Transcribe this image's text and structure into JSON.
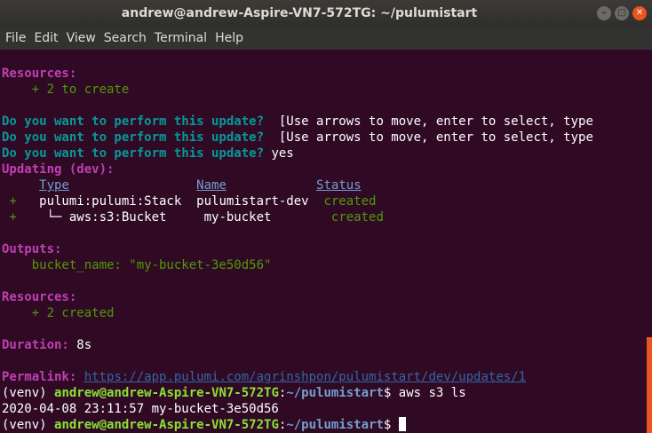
{
  "window": {
    "title": "andrew@andrew-Aspire-VN7-572TG: ~/pulumistart"
  },
  "menu": [
    "File",
    "Edit",
    "View",
    "Search",
    "Terminal",
    "Help"
  ],
  "terminal": {
    "resources1_label": "Resources:",
    "resources1_value": "    + 2 to create",
    "q1_prompt": "Do you want to perform this update?",
    "q1_hint": "  [Use arrows to move, enter to select, type",
    "q2_prompt": "Do you want to perform this update?",
    "q2_hint": "  [Use arrows to move, enter to select, type",
    "q3_prompt": "Do you want to perform this update?",
    "q3_answer": " yes",
    "updating": "Updating (dev):",
    "table": {
      "headers": [
        "Type",
        "Name",
        "Status"
      ],
      "rows": [
        {
          "mark": " +  ",
          "type": " pulumi:pulumi:Stack",
          "name": "pulumistart-dev",
          "status": "created"
        },
        {
          "mark": " +  ",
          "type": "  └─ aws:s3:Bucket",
          "name": "my-bucket",
          "status": "created"
        }
      ]
    },
    "outputs_label": "Outputs:",
    "outputs_value": "    bucket_name: \"my-bucket-3e50d56\"",
    "resources2_label": "Resources:",
    "resources2_value": "    + 2 created",
    "duration_label": "Duration:",
    "duration_value": " 8s",
    "permalink_label": "Permalink:",
    "permalink_url": "https://app.pulumi.com/agrinshpon/pulumistart/dev/updates/1",
    "shell": {
      "venv": "(venv) ",
      "userhost": "andrew@andrew-Aspire-VN7-572TG",
      "colon": ":",
      "path": "~/pulumistart",
      "dollar": "$ ",
      "cmd1": "aws s3 ls",
      "ls_output": "2020-04-08 23:11:57 my-bucket-3e50d56"
    }
  },
  "colors": {
    "background": "#300a24",
    "titlebar": "#3c3b37",
    "accent": "#e95420"
  }
}
